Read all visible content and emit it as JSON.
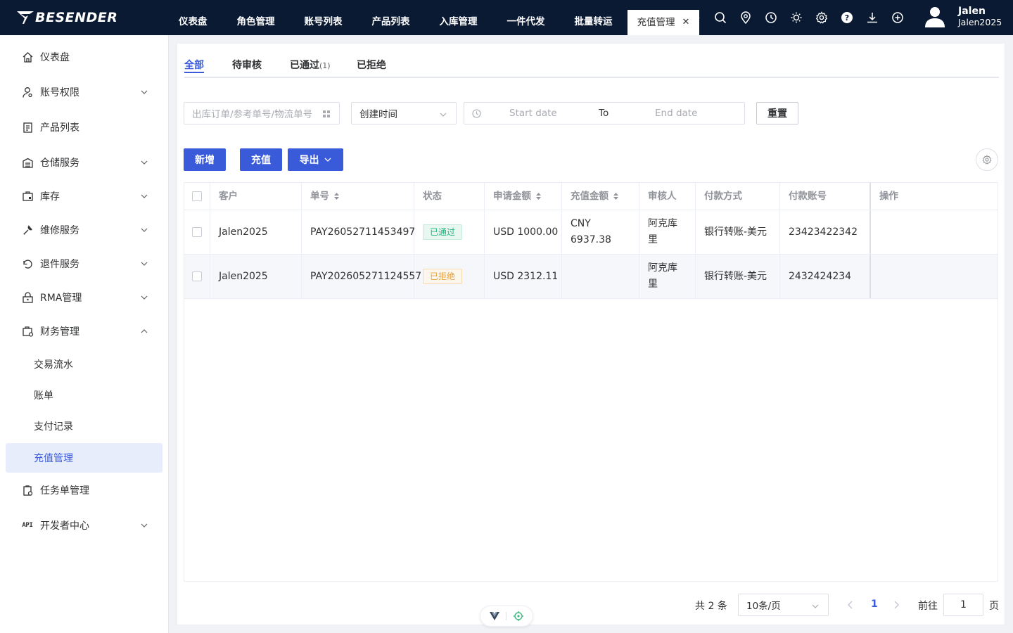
{
  "brand": {
    "name": "BESENDER"
  },
  "topnav": {
    "items": [
      {
        "label": "仪表盘"
      },
      {
        "label": "角色管理"
      },
      {
        "label": "账号列表"
      },
      {
        "label": "产品列表"
      },
      {
        "label": "入库管理"
      },
      {
        "label": "一件代发"
      },
      {
        "label": "批量转运"
      }
    ],
    "active_tab": "充值管理",
    "close_glyph": "✕"
  },
  "top_icons": [
    "search-icon",
    "location-icon",
    "clock-icon",
    "sun-icon",
    "gear-icon",
    "help-icon",
    "download-icon",
    "add-circle-icon"
  ],
  "user": {
    "name": "Jalen",
    "id": "Jalen2025"
  },
  "sidebar": {
    "items": [
      {
        "label": "仪表盘",
        "icon": "home-icon"
      },
      {
        "label": "账号权限",
        "icon": "user-key-icon"
      },
      {
        "label": "产品列表",
        "icon": "product-icon"
      },
      {
        "label": "仓储服务",
        "icon": "warehouse-icon"
      },
      {
        "label": "库存",
        "icon": "inventory-icon"
      },
      {
        "label": "维修服务",
        "icon": "wrench-icon"
      },
      {
        "label": "退件服务",
        "icon": "return-icon"
      },
      {
        "label": "RMA管理",
        "icon": "rma-icon"
      },
      {
        "label": "财务管理",
        "icon": "finance-icon"
      },
      {
        "label": "任务单管理",
        "icon": "task-icon"
      },
      {
        "label": "开发者中心",
        "icon": "api-icon",
        "icon_text": "API"
      }
    ],
    "finance_sub": [
      {
        "label": "交易流水"
      },
      {
        "label": "账单"
      },
      {
        "label": "支付记录"
      },
      {
        "label": "充值管理"
      }
    ]
  },
  "tabs": {
    "all": "全部",
    "pending": "待审核",
    "approved": "已通过",
    "approved_count": "(1)",
    "rejected": "已拒绝"
  },
  "filters": {
    "search_placeholder": "出库订单/参考单号/物流单号",
    "time_select": "创建时间",
    "start_placeholder": "Start date",
    "to": "To",
    "end_placeholder": "End date",
    "reset": "重置"
  },
  "actions": {
    "add": "新增",
    "charge": "充值",
    "export": "导出"
  },
  "table": {
    "headers": [
      "客户",
      "单号",
      "状态",
      "申请金额",
      "充值金额",
      "审核人",
      "付款方式",
      "付款账号",
      "操作"
    ],
    "rows": [
      {
        "customer": "Jalen2025",
        "order_no": "PAY26052711453497",
        "status": "已通过",
        "status_type": "approved",
        "apply_amount": "USD 1000.00",
        "charge_amount_line1": "CNY",
        "charge_amount_line2": "6937.38",
        "reviewer_line1": "阿克库",
        "reviewer_line2": "里",
        "pay_method": "银行转账-美元",
        "pay_account": "23423422342"
      },
      {
        "customer": "Jalen2025",
        "order_no": "PAY202605271124557",
        "status": "已拒绝",
        "status_type": "rejected",
        "apply_amount": "USD 2312.11",
        "charge_amount_line1": "",
        "charge_amount_line2": "",
        "reviewer_line1": "阿克库",
        "reviewer_line2": "里",
        "pay_method": "银行转账-美元",
        "pay_account": "2432424234"
      }
    ]
  },
  "pagination": {
    "total": "共 2 条",
    "page_size": "10条/页",
    "current": "1",
    "goto": "前往",
    "goto_value": "1",
    "page_suffix": "页"
  },
  "colors": {
    "primary": "#3a5bd9",
    "topbar": "#0b1a33",
    "success": "#20b37f",
    "warning": "#e6a23c"
  }
}
